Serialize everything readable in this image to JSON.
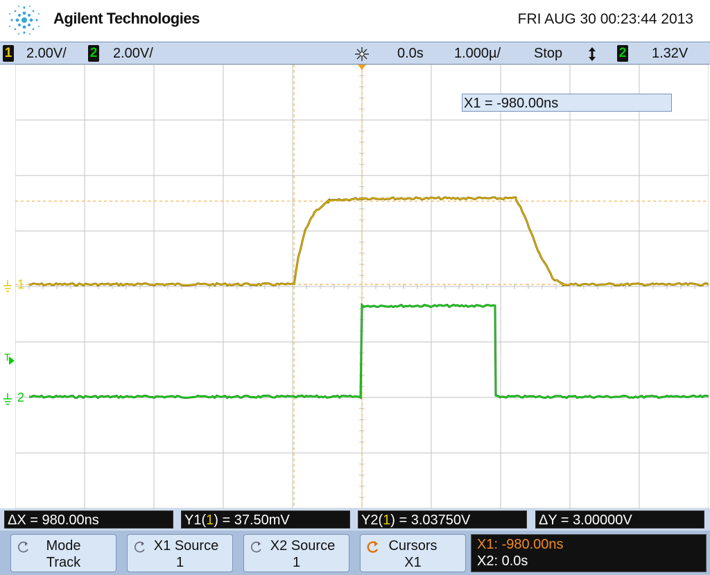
{
  "header": {
    "brand": "Agilent Technologies",
    "datetime": "FRI AUG 30 00:23:44 2013"
  },
  "status": {
    "ch1_num": "1",
    "ch1_scale": "2.00V/",
    "ch2_num": "2",
    "ch2_scale": "2.00V/",
    "trig_icon": "trigger-sparkle-icon",
    "delay": "0.0s",
    "timebase": "1.000µ/",
    "run_state": "Stop",
    "trig_slope_icon": "updown-arrow-icon",
    "trig_ch": "2",
    "trig_level": "1.32V"
  },
  "cursor_readout": "X1 = -980.00ns",
  "markers": {
    "ch1": "1",
    "ch2": "2",
    "trig": "T"
  },
  "measurements": {
    "dx": "ΔX = 980.00ns",
    "y1_pre": "Y1(",
    "y1_ch": "1",
    "y1_post": ") = 37.50mV",
    "y2_pre": "Y2(",
    "y2_ch": "1",
    "y2_post": ") = 3.03750V",
    "dy": "ΔY = 3.00000V"
  },
  "softkeys": {
    "mode_l1": "Mode",
    "mode_l2": "Track",
    "x1src_l1": "X1 Source",
    "x1src_l2": "1",
    "x2src_l1": "X2 Source",
    "x2src_l2": "1",
    "cursors_l1": "Cursors",
    "cursors_l2": "X1",
    "x1_val": "X1: -980.00ns",
    "x2_val": "X2: 0.0s"
  },
  "colors": {
    "ch1": "#e8c800",
    "ch1_trace": "#9a7a18",
    "ch2": "#00cc00",
    "ch2_trace": "#1a8a1a",
    "cursor": "#f0a020",
    "grid": "#c0c0c0",
    "screen_bg": "#ffffff"
  }
}
